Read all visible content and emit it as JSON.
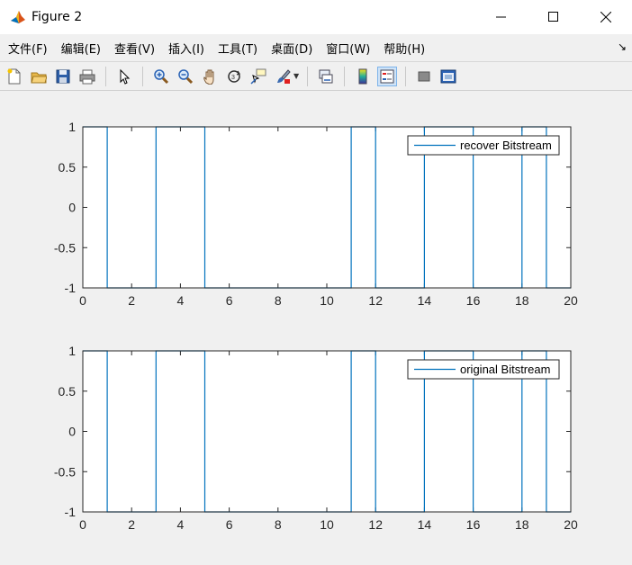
{
  "window": {
    "title": "Figure 2"
  },
  "menu": {
    "items": [
      "文件(F)",
      "编辑(E)",
      "查看(V)",
      "插入(I)",
      "工具(T)",
      "桌面(D)",
      "窗口(W)",
      "帮助(H)"
    ]
  },
  "toolbar": {
    "icons": [
      "new-file-icon",
      "open-folder-icon",
      "save-icon",
      "print-icon",
      "pointer-icon",
      "zoom-in-icon",
      "zoom-out-icon",
      "pan-hand-icon",
      "rotate-3d-icon",
      "data-cursor-icon",
      "brush-icon",
      "link-plot-icon",
      "colorbar-icon",
      "legend-icon",
      "hide-plot-tools-icon",
      "show-plot-tools-icon"
    ]
  },
  "chart_data": [
    {
      "type": "line",
      "legend": "recover Bitstream",
      "legend_position": "top-right",
      "line_color": "#0072bd",
      "xlim": [
        0,
        20
      ],
      "ylim": [
        -1,
        1
      ],
      "xticks": [
        "0",
        "2",
        "4",
        "6",
        "8",
        "10",
        "12",
        "14",
        "16",
        "18",
        "20"
      ],
      "yticks": [
        "1",
        "0.5",
        "0",
        "-0.5",
        "-1"
      ],
      "x": [
        0,
        1,
        1,
        3,
        3,
        5,
        5,
        11,
        11,
        12,
        12,
        14,
        14,
        16,
        16,
        18,
        18,
        19,
        19,
        20
      ],
      "y": [
        1,
        1,
        -1,
        -1,
        1,
        1,
        -1,
        -1,
        1,
        1,
        -1,
        -1,
        1,
        1,
        -1,
        -1,
        1,
        1,
        -1,
        -1
      ]
    },
    {
      "type": "line",
      "legend": "original Bitstream",
      "legend_position": "top-right",
      "line_color": "#0072bd",
      "xlim": [
        0,
        20
      ],
      "ylim": [
        -1,
        1
      ],
      "xticks": [
        "0",
        "2",
        "4",
        "6",
        "8",
        "10",
        "12",
        "14",
        "16",
        "18",
        "20"
      ],
      "yticks": [
        "1",
        "0.5",
        "0",
        "-0.5",
        "-1"
      ],
      "x": [
        0,
        1,
        1,
        3,
        3,
        5,
        5,
        11,
        11,
        12,
        12,
        14,
        14,
        16,
        16,
        18,
        18,
        19,
        19,
        20
      ],
      "y": [
        1,
        1,
        -1,
        -1,
        1,
        1,
        -1,
        -1,
        1,
        1,
        -1,
        -1,
        1,
        1,
        -1,
        -1,
        1,
        1,
        -1,
        -1
      ]
    }
  ]
}
